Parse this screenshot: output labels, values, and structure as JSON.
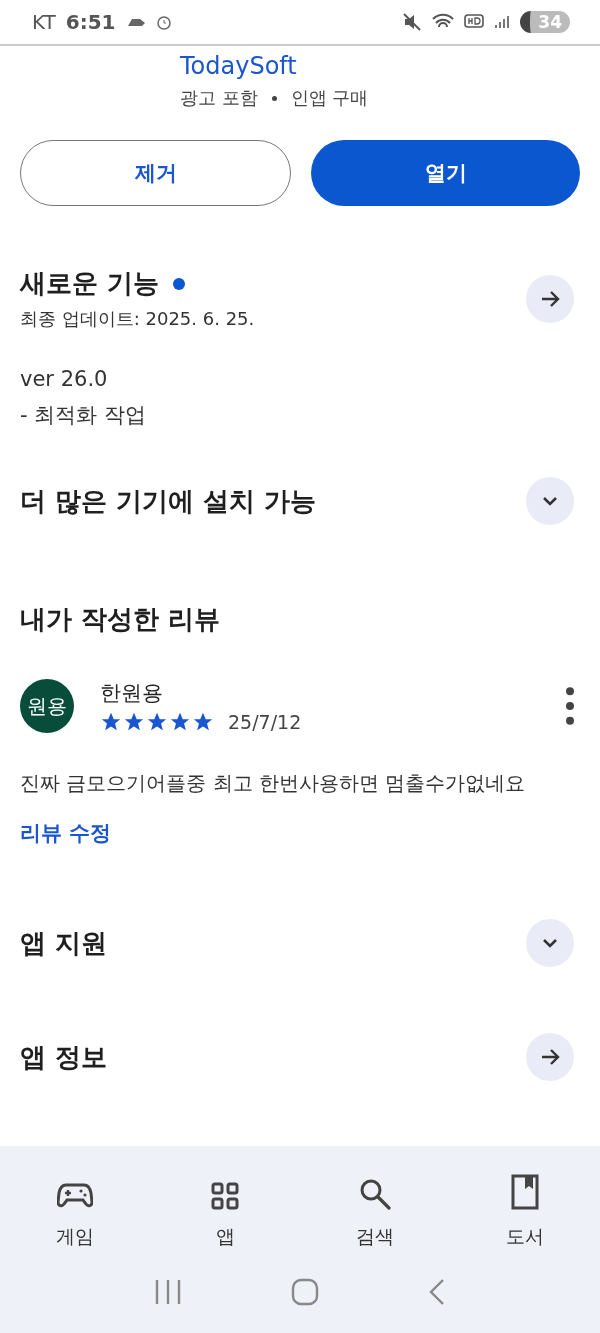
{
  "status_bar": {
    "carrier": "KT",
    "time": "6:51",
    "battery": "34"
  },
  "app": {
    "developer": "TodaySoft",
    "tags": [
      "광고 포함",
      "인앱 구매"
    ]
  },
  "buttons": [
    {
      "label": "제거",
      "kind": "outline"
    },
    {
      "label": "열기",
      "kind": "filled"
    }
  ],
  "whats_new": {
    "title": "새로운 기능",
    "unread": true,
    "updated": "최종 업데이트: 2025. 6. 25.",
    "lines": [
      "ver 26.0",
      "- 최적화 작업"
    ]
  },
  "more_devices": {
    "title": "더 많은 기기에 설치 가능",
    "expanded": false
  },
  "my_review": {
    "title": "내가 작성한 리뷰",
    "avatar": "원용",
    "author": "한원용",
    "stars": 5,
    "date": "25/7/12",
    "text": "진짜 금모으기어플중 최고 한번사용하면 멈출수가없네요",
    "edit_link": "리뷰 수정"
  },
  "app_support": {
    "title": "앱 지원",
    "expanded": false
  },
  "app_info": {
    "title": "앱 정보"
  },
  "bottom_nav": [
    {
      "label": "게임",
      "kind": "game",
      "selected": false
    },
    {
      "label": "앱",
      "kind": "apps",
      "selected": false
    },
    {
      "label": "검색",
      "kind": "search",
      "selected": false
    },
    {
      "label": "도서",
      "kind": "book",
      "selected": false
    }
  ]
}
